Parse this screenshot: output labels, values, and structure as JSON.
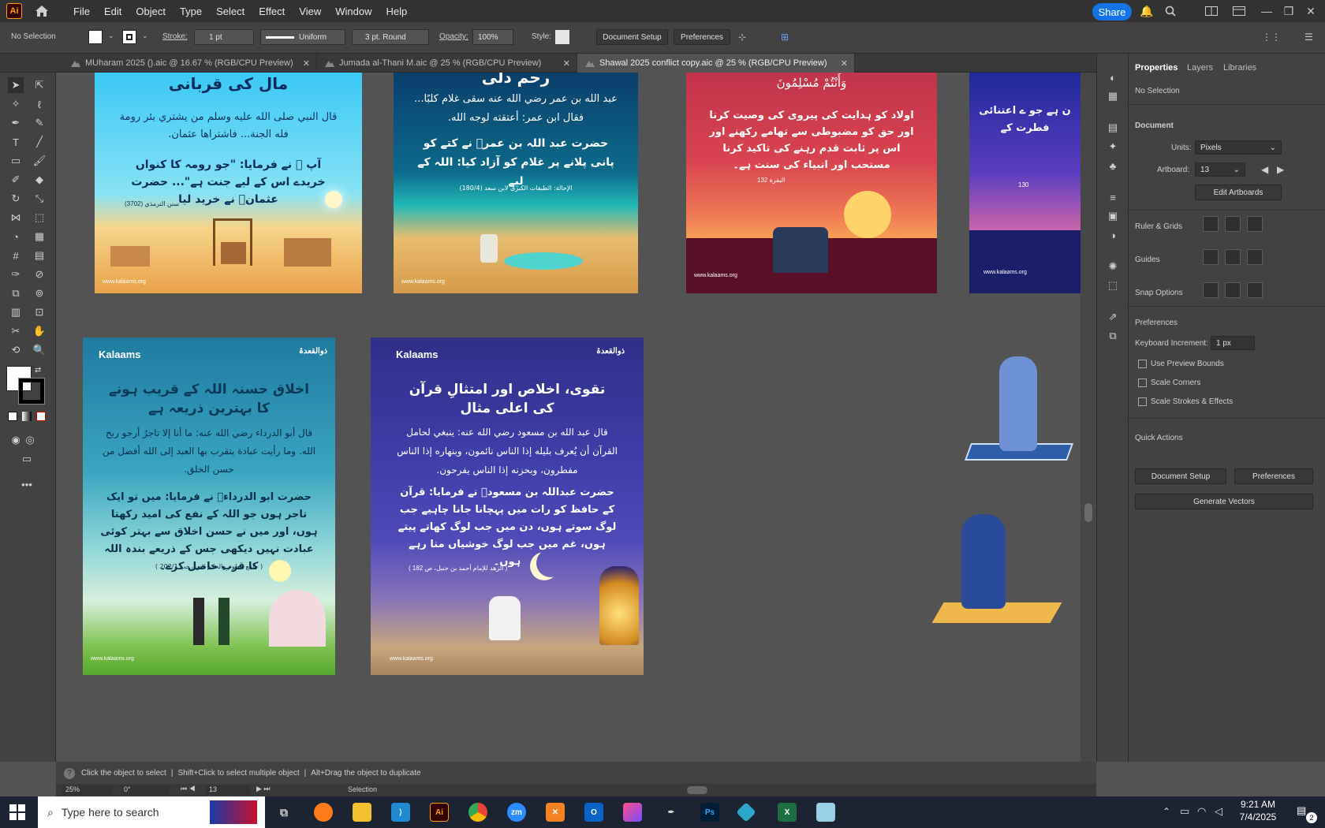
{
  "app": {
    "logo": "Ai",
    "brand_color": "#ff9a00"
  },
  "menu": [
    "File",
    "Edit",
    "Object",
    "Type",
    "Select",
    "Effect",
    "View",
    "Window",
    "Help"
  ],
  "share_label": "Share",
  "control": {
    "selection": "No Selection",
    "stroke_label": "Stroke:",
    "stroke_value": "1 pt",
    "uniform": "Uniform",
    "brush": "3 pt. Round",
    "opacity_label": "Opacity:",
    "opacity_value": "100%",
    "style_label": "Style:",
    "document_setup": "Document Setup",
    "preferences": "Preferences"
  },
  "tabs": [
    {
      "label": "MUharam 2025 ().aic @ 16.67 % (RGB/CPU Preview)"
    },
    {
      "label": "Jumada al-Thani M.aic @ 25 % (RGB/CPU Preview)"
    },
    {
      "label": "Shawal 2025 conflict copy.aic @ 25 % (RGB/CPU Preview)"
    }
  ],
  "artboards": {
    "a1": {
      "title": "مال کی قربانی",
      "arabic": "قال النبي صلى الله عليه وسلم من يشتري بئر رومة فله الجنة... فاشتراها عثمان.",
      "urdu": "آپ ﷺ نے فرمایا: \"جو رومہ کا کنواں خریدے اس کے لیے جنت ہے\"... حضرت عثمانؓ نے خرید لیا",
      "ref": "سنن الترمذي (3702)",
      "url": "www.kalaams.org"
    },
    "a2": {
      "title": "رحم دلی",
      "arabic": "عبد الله بن عمر رضي الله عنه سقى غلام كلبًا... فقال ابن عمر: أعتقته لوجه الله.",
      "urdu": "حضرت عبد اللہ بن عمرؓ نے کتے کو پانی پلانے پر غلام کو آزاد کیا: اللہ کے لیے",
      "ref": "الإحالة: الطبقات الكبرى لابن سعد (180/4)",
      "url": "www.kalaams.org"
    },
    "a3": {
      "ayah": "وَأَنْتُمْ مُسْلِمُونَ",
      "urdu": "اولاد کو ہدایت کی پیروی کی وصیت کرنا اور حق کو مضبوطی سے تھامے رکھنے اور اس پر ثابت قدم رہنے کی تاکید کرنا مستحب اور انبیاء کی سنت ہے۔",
      "ref": "البقرة 132",
      "url": "www.kalaams.org"
    },
    "a4": {
      "urdu": "ن ہے جو ے اعتنائی فطرت کے",
      "ref": "130",
      "url": "www.kalaams.org"
    },
    "a5": {
      "brand": "Kalaams",
      "month": "ذوالقعدۃ",
      "title": "اخلاق حسنہ اللہ کے قریب ہونے کا بہترین ذریعہ ہے",
      "arabic": "قال أبو الدرداء رضي الله عنه: ما أنا إلا تاجرٌ أرجو ربح الله. وما رأيت عبادة يتقرب بها العبد إلى الله أفضل من حسن الخلق.",
      "urdu": "حضرت ابو الدرداءؓ نے فرمایا: میں تو ایک تاجر ہوں جو اللہ کے نفع کی امید رکھتا ہوں، اور میں نے حسن اخلاق سے بہتر کوئی عبادت نہیں دیکھی جس کے ذریعے بندہ اللہ کا قرب حاصل کرے۔",
      "ref": "( جامع العلوم والحكم لابن رجب 202/1 )",
      "url": "www.kalaams.org"
    },
    "a6": {
      "brand": "Kalaams",
      "month": "ذوالقعدۃ",
      "title": "تقوی، اخلاص اور امتثالِ قرآن کی اعلی مثال",
      "arabic": "قال عبد الله بن مسعود رضي الله عنه: ينبغي لحامل القرآن أن يُعرف بليله إذا الناس نائمون، وبنهاره إذا الناس مفطرون، وبحزنه إذا الناس يفرحون.",
      "urdu": "حضرت عبداللہ بن مسعودؓ نے فرمایا: قرآن کے حافظ کو رات میں پہچانا جانا چاہیے جب لوگ سوتے ہوں، دن میں جب لوگ کھاتے پیتے ہوں، غم میں جب لوگ خوشیاں منا رہے ہوں۔",
      "ref": "( الزهد للإمام أحمد بن حنبل، ص 182 )",
      "url": "www.kalaams.org"
    }
  },
  "panel": {
    "tabs": [
      "Properties",
      "Layers",
      "Libraries"
    ],
    "no_selection": "No Selection",
    "document": "Document",
    "units_label": "Units:",
    "units_value": "Pixels",
    "artboard_label": "Artboard:",
    "artboard_value": "13",
    "edit_artboards": "Edit Artboards",
    "ruler_grids": "Ruler & Grids",
    "guides": "Guides",
    "snap_options": "Snap Options",
    "preferences": "Preferences",
    "keyboard_increment_label": "Keyboard Increment:",
    "keyboard_increment_value": "1 px",
    "use_preview_bounds": "Use Preview Bounds",
    "scale_corners": "Scale Corners",
    "scale_strokes": "Scale Strokes & Effects",
    "quick_actions": "Quick Actions",
    "document_setup": "Document Setup",
    "preferences_btn": "Preferences",
    "generate_vectors": "Generate Vectors"
  },
  "status": {
    "hint_1": "Click the object to select",
    "hint_2": "Shift+Click to select multiple object",
    "hint_3": "Alt+Drag the object to duplicate",
    "zoom": "25%",
    "rotation": "0°",
    "artboard": "13",
    "tool": "Selection"
  },
  "taskbar": {
    "search_placeholder": "Type here to search",
    "time": "9:21 AM",
    "date": "7/4/2025",
    "notifications": "2"
  }
}
